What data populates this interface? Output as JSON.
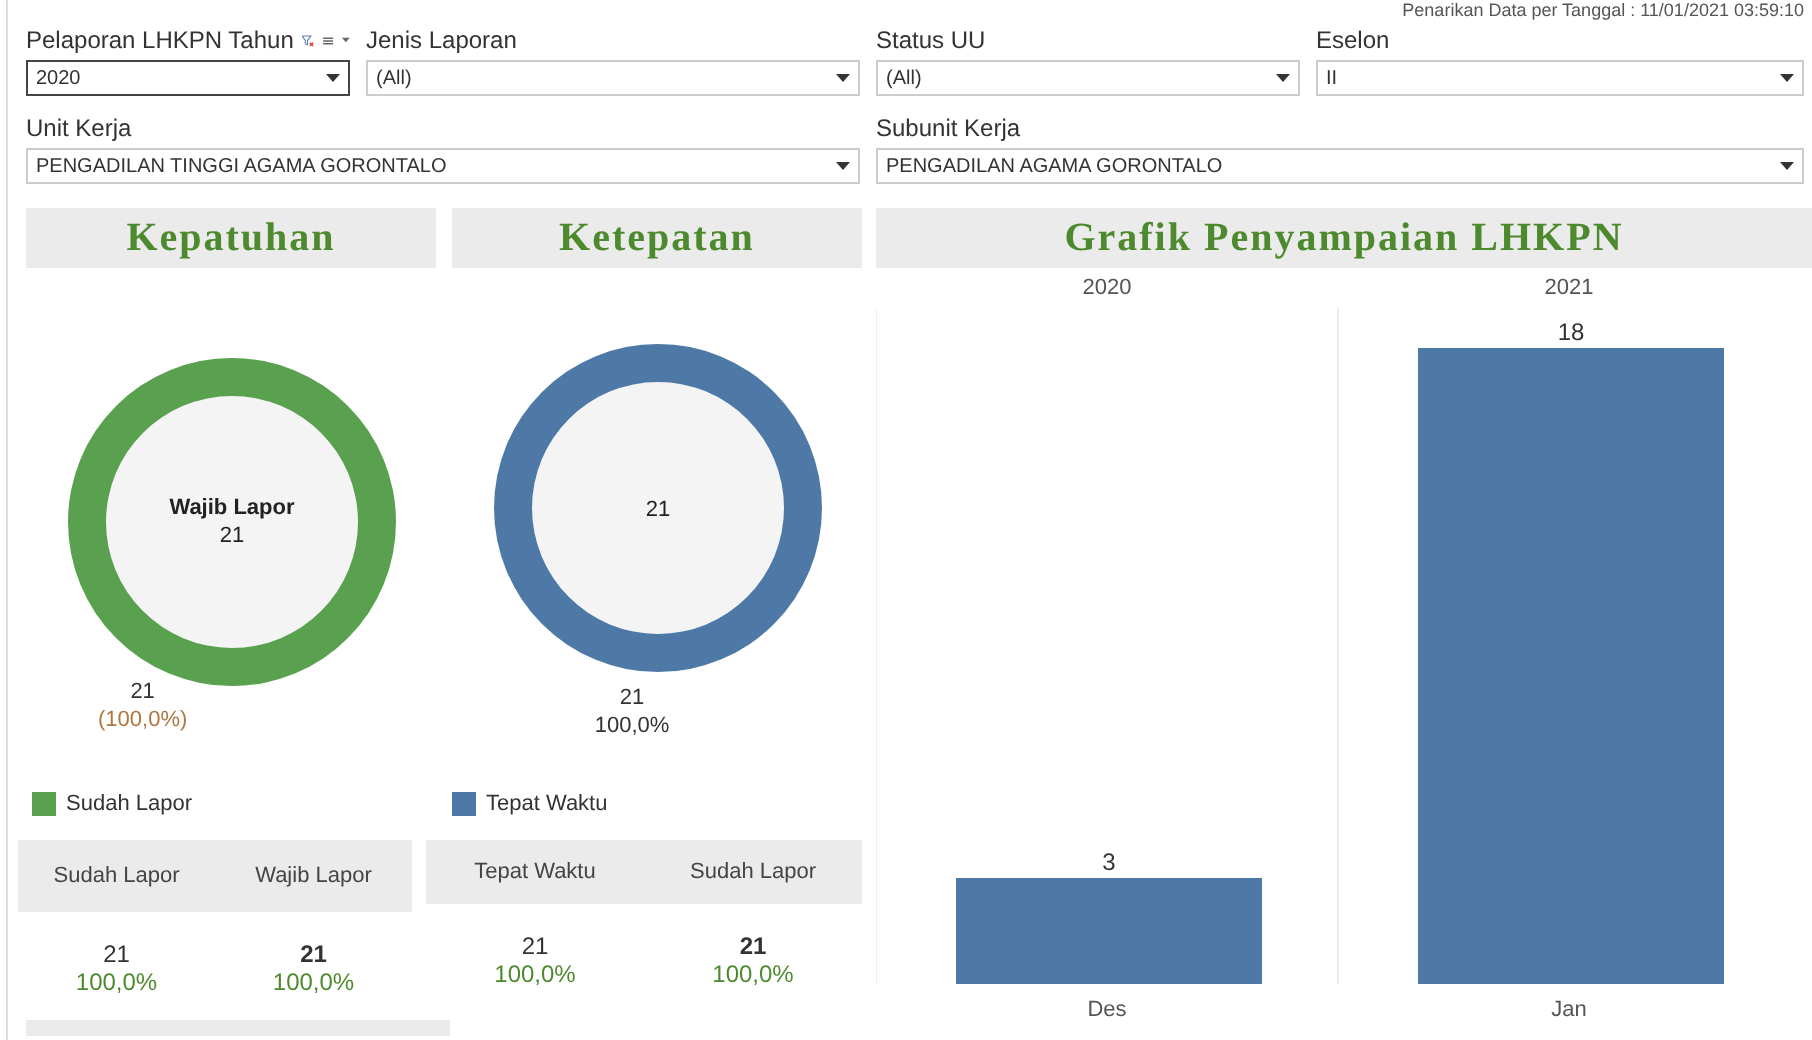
{
  "header": {
    "timestamp": "Penarikan Data per Tanggal : 11/01/2021 03:59:10"
  },
  "filters_top": [
    {
      "label": "Pelaporan LHKPN Tahun",
      "value": "2020",
      "active": true,
      "has_tools": true
    },
    {
      "label": "Jenis Laporan",
      "value": "(All)",
      "active": false,
      "has_tools": false
    },
    {
      "label": "Status UU",
      "value": "(All)",
      "active": false,
      "has_tools": false
    },
    {
      "label": "Eselon",
      "value": "II",
      "active": false,
      "has_tools": false
    }
  ],
  "filters_bottom": [
    {
      "label": "Unit Kerja",
      "value": "PENGADILAN TINGGI AGAMA GORONTALO",
      "active": false,
      "has_tools": false
    },
    {
      "label": "Subunit Kerja",
      "value": "PENGADILAN AGAMA GORONTALO",
      "active": false,
      "has_tools": false
    }
  ],
  "panels": [
    {
      "title": "Kepatuhan",
      "center_label": "Wajib Lapor",
      "center_value": "21",
      "value_label": "21",
      "percent_label": "(100,0%)",
      "legend": {
        "label": "Sudah Lapor",
        "color": "#59a14f"
      },
      "table": {
        "columns": [
          "Sudah Lapor",
          "Wajib Lapor"
        ],
        "rows": [
          [
            {
              "value": "21",
              "percent": "100,0%"
            },
            {
              "value": "21",
              "percent": "100,0%"
            }
          ]
        ]
      }
    },
    {
      "title": "Ketepatan",
      "center_value": "21",
      "value_label": "21",
      "percent_label": "100,0%",
      "legend": {
        "label": "Tepat Waktu",
        "color": "#4e79a7"
      },
      "table": {
        "columns": [
          "Tepat Waktu",
          "Sudah Lapor"
        ],
        "rows": [
          [
            {
              "value": "21",
              "percent": "100,0%"
            },
            {
              "value": "21",
              "percent": "100,0%"
            }
          ]
        ]
      }
    }
  ],
  "grafik": {
    "title": "Grafik Penyampaian LHKPN",
    "year_headers": [
      "2020",
      "2021"
    ],
    "chart_data": {
      "type": "bar",
      "categories": [
        "Des",
        "Jan"
      ],
      "values": [
        3,
        18
      ],
      "data_labels": true
    }
  }
}
